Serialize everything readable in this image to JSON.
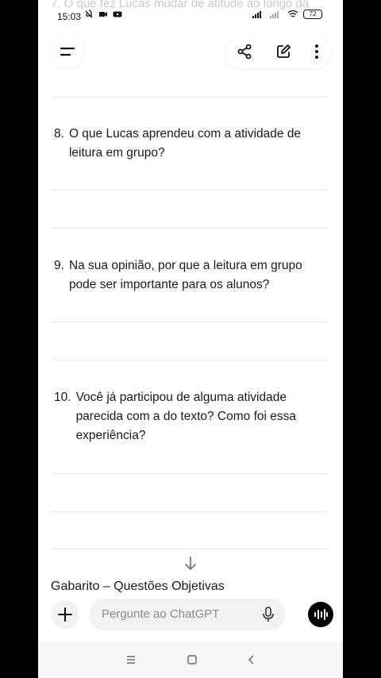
{
  "status_bar": {
    "time": "15:03",
    "battery": "72"
  },
  "ghost_text": "7. O que fez Lucas mudar de atitude ao longo da",
  "questions": [
    {
      "number": "8.",
      "text": "O que Lucas aprendeu com a atividade de leitura em grupo?"
    },
    {
      "number": "9.",
      "text": "Na sua opinião, por que a leitura em grupo pode ser importante para os alunos?"
    },
    {
      "number": "10.",
      "text": "Você já participou de alguma atividade parecida com a do texto? Como foi essa experiência?"
    }
  ],
  "section_title": "Gabarito – Questões Objetivas",
  "composer": {
    "placeholder": "Pergunte ao ChatGPT"
  },
  "icons": {
    "menu": "menu-icon",
    "share": "share-icon",
    "edit": "edit-icon",
    "more": "more-vertical-icon",
    "scroll": "arrow-down-icon",
    "plus": "plus-icon",
    "mic": "mic-icon",
    "voice": "voice-wave-icon"
  }
}
